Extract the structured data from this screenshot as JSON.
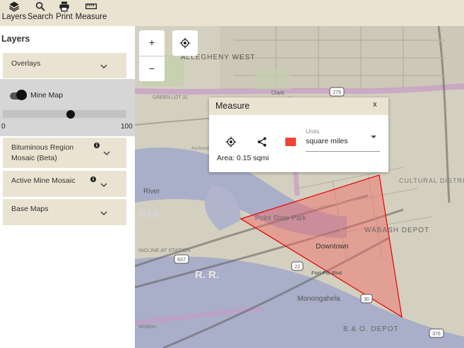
{
  "toolbar": {
    "items": [
      {
        "label": "Layers",
        "icon": "layers-icon"
      },
      {
        "label": "Search",
        "icon": "search-icon"
      },
      {
        "label": "Print",
        "icon": "print-icon"
      },
      {
        "label": "Measure",
        "icon": "ruler-icon"
      }
    ]
  },
  "sidebar": {
    "title": "Layers",
    "overlays": {
      "label": "Overlays",
      "mine_map": {
        "label": "Mine Map",
        "enabled": true
      },
      "opacity_slider": {
        "min": "0",
        "max": "100",
        "value": 55
      }
    },
    "panels": [
      {
        "label": "Bituminous Region Mosaic (Beta)",
        "info": "i"
      },
      {
        "label": "Active Mine Mosaic",
        "info": "i"
      },
      {
        "label": "Base Maps"
      }
    ]
  },
  "map": {
    "zoom_in": "+",
    "zoom_out": "−",
    "labels": {
      "allegheny_west": "ALLEGHENY WEST",
      "cultural_district": "CULTURAL DISTRICT",
      "point_state_park": "Point State Park",
      "downtown": "Downtown",
      "monongahela": "Monongahela",
      "wabash_depot": "WABASH DEPOT",
      "bo_depot": "B.& O. DEPOT",
      "river": "River",
      "rie": "RIE",
      "rr": "R. R.",
      "green_lot": "GREEN LOT 31",
      "clark": "Clark",
      "fort_pitt": "Fort Pitt Blvd",
      "acrisure": "Acrisure Stadium",
      "incline": "INCLINE AT STATION",
      "whittier": "Whittier",
      "shield_279": "279",
      "shield_22": "22",
      "shield_30": "30",
      "shield_837": "837",
      "shield_376": "376"
    }
  },
  "measure": {
    "title": "Measure",
    "close": "x",
    "units_label": "Units",
    "units_value": "square miles",
    "area_text": "Area:  0.15 sqmi",
    "color": "#f44336"
  },
  "colors": {
    "panel_bg": "#ebe3d2",
    "measure_stroke": "#e60000"
  }
}
